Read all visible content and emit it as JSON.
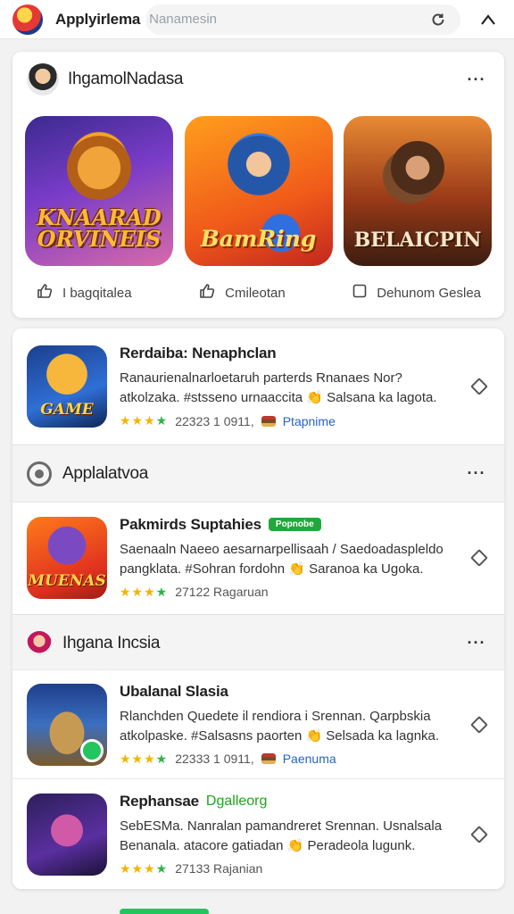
{
  "topbar": {
    "app_title": "Applyirlema",
    "search_placeholder": "Nanamesin",
    "refresh_icon": "refresh-icon",
    "close_icon": "close-icon"
  },
  "featured": {
    "title": "IhgamolNadasa",
    "more_label": "···",
    "games": [
      {
        "label_line1": "KNAARAD",
        "label_line2": "ORVINEIS"
      },
      {
        "label_line1": "BamRing",
        "label_line2": ""
      },
      {
        "label_line1": "BELAICPIN",
        "label_line2": ""
      }
    ],
    "actions": [
      {
        "icon": "thumbs-up-icon",
        "label": "I bagqitalea"
      },
      {
        "icon": "thumbs-up-icon",
        "label": "Cmileotan"
      },
      {
        "icon": "bookmark-icon",
        "label": "Dehunom Geslea"
      }
    ]
  },
  "apps": [
    {
      "name": "Rerdaiba: Nenaphclan",
      "icon_text": "GAME",
      "tag": "",
      "tag_style": "",
      "desc_line1": "Ranaurienalnarloetaruh parterds Rnanaes Nor?",
      "desc_line2": "atkolzaka. #stsseno urnaaccita 👏 Salsana ka lagota.",
      "rating_text": "22323 1 0911,",
      "publisher": "Ptapnime"
    },
    {
      "name": "Pakmirds Suptahies",
      "icon_text": "MUENAS",
      "tag": "Popnobe",
      "tag_style": "badge",
      "desc_line1": "Saenaaln Naeeo aesarnarpellisaah / Saedoadaspleldo",
      "desc_line2": "pangklata. #Sohran fordohn 👏 Saranoa ka Ugoka.",
      "rating_text": "27122 Ragaruan",
      "publisher": ""
    },
    {
      "name": "Ubalanal Slasia",
      "icon_text": "",
      "tag": "",
      "tag_style": "",
      "desc_line1": "Rlanchden Quedete il rendiora i Srennan. Qarpbskia",
      "desc_line2": "atkolpaske. #Salsasns paorten 👏 Selsada ka lagnka.",
      "rating_text": "22333 1 0911,",
      "publisher": "Paenuma"
    },
    {
      "name": "Rephansae",
      "icon_text": "",
      "tag": "Dgalleorg",
      "tag_style": "text",
      "desc_line1": "SebESMa. Nanralan pamandreret Srennan. Usnalsala",
      "desc_line2": "Benanala. atacore gatiadan 👏 Peradeola lugunk.",
      "rating_text": "27133 Rajanian",
      "publisher": ""
    }
  ],
  "sections": [
    {
      "title": "Applalatvoa",
      "more_label": "···"
    },
    {
      "title": "Ihgana Incsia",
      "more_label": "···"
    }
  ],
  "stars": "★★★",
  "colors": {
    "accent_green": "#22a83a",
    "star_yellow": "#f4b400",
    "link_blue": "#2563c4"
  }
}
